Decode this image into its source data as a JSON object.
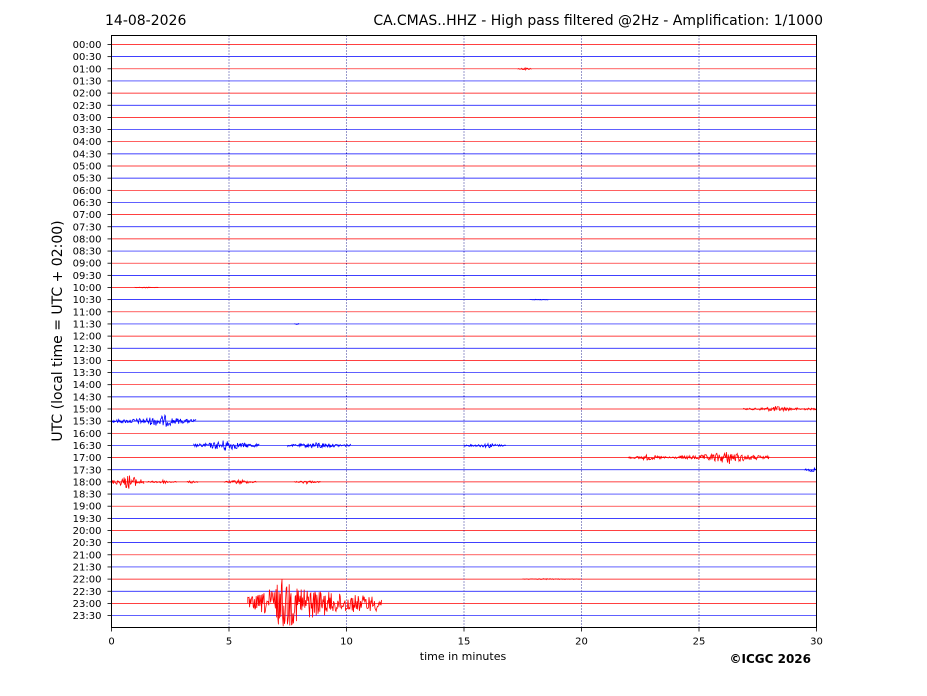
{
  "header": {
    "date": "14-08-2026",
    "title": "CA.CMAS..HHZ - High pass filtered @2Hz - Amplification: 1/1000"
  },
  "footer": {
    "copyright": "©ICGC 2026"
  },
  "chart_data": {
    "type": "line",
    "title": "CA.CMAS..HHZ - High pass filtered @2Hz - Amplification: 1/1000",
    "xlabel": "time in minutes",
    "ylabel": "UTC (local time = UTC + 02:00)",
    "xlim": [
      0,
      30
    ],
    "xticks": [
      0,
      5,
      10,
      15,
      20,
      25,
      30
    ],
    "grid_x": true,
    "colors": {
      "odd_rows": "#ff0000",
      "even_rows": "#0000ff",
      "axis": "#000000"
    },
    "rows": [
      "00:00",
      "00:30",
      "01:00",
      "01:30",
      "02:00",
      "02:30",
      "03:00",
      "03:30",
      "04:00",
      "04:30",
      "05:00",
      "05:30",
      "06:00",
      "06:30",
      "07:00",
      "07:30",
      "08:00",
      "08:30",
      "09:00",
      "09:30",
      "10:00",
      "10:30",
      "11:00",
      "11:30",
      "12:00",
      "12:30",
      "13:00",
      "13:30",
      "14:00",
      "14:30",
      "15:00",
      "15:30",
      "16:00",
      "16:30",
      "17:00",
      "17:30",
      "18:00",
      "18:30",
      "19:00",
      "19:30",
      "20:00",
      "20:30",
      "21:00",
      "21:30",
      "22:00",
      "22:30",
      "23:00",
      "23:30"
    ],
    "events": [
      {
        "row": "01:00",
        "start": 17.3,
        "end": 17.9,
        "amp": 0.15,
        "peak_at": 17.6
      },
      {
        "row": "10:00",
        "start": 1.0,
        "end": 2.0,
        "amp": 0.06,
        "peak_at": 1.5
      },
      {
        "row": "10:30",
        "start": 17.8,
        "end": 18.6,
        "amp": 0.05,
        "peak_at": 18.2
      },
      {
        "row": "11:30",
        "start": 7.8,
        "end": 8.0,
        "amp": 0.08,
        "peak_at": 7.9
      },
      {
        "row": "15:00",
        "start": 26.9,
        "end": 30.0,
        "amp": 0.25,
        "peak_at": 28.3
      },
      {
        "row": "15:30",
        "start": 0.0,
        "end": 3.6,
        "amp": 0.5,
        "peak_at": 2.3
      },
      {
        "row": "16:30",
        "start": 3.5,
        "end": 6.3,
        "amp": 0.5,
        "peak_at": 4.9
      },
      {
        "row": "16:30",
        "start": 7.5,
        "end": 10.2,
        "amp": 0.3,
        "peak_at": 8.8
      },
      {
        "row": "16:30",
        "start": 15.0,
        "end": 16.8,
        "amp": 0.22,
        "peak_at": 16.1
      },
      {
        "row": "17:00",
        "start": 22.0,
        "end": 24.2,
        "amp": 0.25,
        "peak_at": 22.8
      },
      {
        "row": "17:00",
        "start": 24.2,
        "end": 28.0,
        "amp": 0.55,
        "peak_at": 26.3
      },
      {
        "row": "17:30",
        "start": 29.5,
        "end": 30.0,
        "amp": 0.25,
        "peak_at": 29.9
      },
      {
        "row": "18:00",
        "start": 0.0,
        "end": 1.4,
        "amp": 0.7,
        "peak_at": 0.8
      },
      {
        "row": "18:00",
        "start": 1.5,
        "end": 2.8,
        "amp": 0.18,
        "peak_at": 2.2
      },
      {
        "row": "18:00",
        "start": 3.2,
        "end": 3.7,
        "amp": 0.15,
        "peak_at": 3.4
      },
      {
        "row": "18:00",
        "start": 4.8,
        "end": 6.2,
        "amp": 0.22,
        "peak_at": 5.5
      },
      {
        "row": "18:00",
        "start": 7.8,
        "end": 8.9,
        "amp": 0.18,
        "peak_at": 8.3
      },
      {
        "row": "22:00",
        "start": 17.5,
        "end": 20.0,
        "amp": 0.05,
        "peak_at": 18.5
      },
      {
        "row": "23:00",
        "start": 5.8,
        "end": 11.5,
        "amp": 2.2,
        "peak_at": 7.3
      }
    ]
  }
}
